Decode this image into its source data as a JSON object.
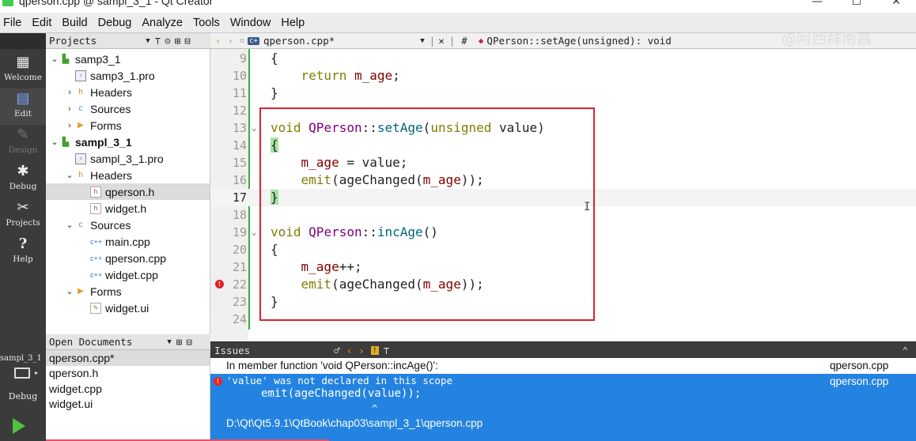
{
  "window": {
    "title": "qperson.cpp @ sampl_3_1 - Qt Creator",
    "minimize": "—",
    "maximize": "☐",
    "close": "✕"
  },
  "menu": [
    "File",
    "Edit",
    "Build",
    "Debug",
    "Analyze",
    "Tools",
    "Window",
    "Help"
  ],
  "modes": [
    {
      "label": "Welcome",
      "icon": "grid-icon",
      "glyph": "▦"
    },
    {
      "label": "Edit",
      "icon": "edit-icon",
      "glyph": "▤"
    },
    {
      "label": "Design",
      "icon": "design-pen-icon",
      "glyph": "✎"
    },
    {
      "label": "Debug",
      "icon": "bug-icon",
      "glyph": "✱"
    },
    {
      "label": "Projects",
      "icon": "wrench-icon",
      "glyph": "✂"
    },
    {
      "label": "Help",
      "icon": "help-icon",
      "glyph": "?"
    }
  ],
  "target": {
    "project": "sampl_3_1",
    "config": "Debug"
  },
  "projects_panel": {
    "title": "Projects"
  },
  "tree": [
    {
      "label": "samp3_1",
      "depth": 0,
      "arrow": "⌄",
      "icon": "proj",
      "glyph": "▙",
      "bold": false
    },
    {
      "label": "samp3_1.pro",
      "depth": 1,
      "arrow": "",
      "icon": "pro",
      "glyph": "▫",
      "bold": false
    },
    {
      "label": "Headers",
      "depth": 1,
      "arrow": "›",
      "icon": "folder",
      "glyph": "h",
      "bold": false
    },
    {
      "label": "Sources",
      "depth": 1,
      "arrow": "›",
      "icon": "src",
      "glyph": "c",
      "bold": false
    },
    {
      "label": "Forms",
      "depth": 1,
      "arrow": "›",
      "icon": "forms",
      "glyph": "▶",
      "bold": false
    },
    {
      "label": "sampl_3_1",
      "depth": 0,
      "arrow": "⌄",
      "icon": "proj",
      "glyph": "▙",
      "bold": true
    },
    {
      "label": "sampl_3_1.pro",
      "depth": 1,
      "arrow": "",
      "icon": "pro",
      "glyph": "▫",
      "bold": false
    },
    {
      "label": "Headers",
      "depth": 1,
      "arrow": "⌄",
      "icon": "folder",
      "glyph": "h",
      "bold": false
    },
    {
      "label": "qperson.h",
      "depth": 2,
      "arrow": "",
      "icon": "hdr",
      "glyph": "h",
      "bold": false,
      "selected": true
    },
    {
      "label": "widget.h",
      "depth": 2,
      "arrow": "",
      "icon": "hdr",
      "glyph": "h",
      "bold": false
    },
    {
      "label": "Sources",
      "depth": 1,
      "arrow": "⌄",
      "icon": "src",
      "glyph": "c",
      "bold": false
    },
    {
      "label": "main.cpp",
      "depth": 2,
      "arrow": "",
      "icon": "cpp",
      "glyph": "c++",
      "bold": false
    },
    {
      "label": "qperson.cpp",
      "depth": 2,
      "arrow": "",
      "icon": "cpp",
      "glyph": "c++",
      "bold": false
    },
    {
      "label": "widget.cpp",
      "depth": 2,
      "arrow": "",
      "icon": "cpp",
      "glyph": "c++",
      "bold": false
    },
    {
      "label": "Forms",
      "depth": 1,
      "arrow": "⌄",
      "icon": "forms",
      "glyph": "▶",
      "bold": false
    },
    {
      "label": "widget.ui",
      "depth": 2,
      "arrow": "",
      "icon": "ui",
      "glyph": "✎",
      "bold": false
    }
  ],
  "open_documents": {
    "title": "Open Documents",
    "docs": [
      "qperson.cpp*",
      "qperson.h",
      "widget.cpp",
      "widget.ui"
    ]
  },
  "editor": {
    "file_tab": "qperson.cpp*",
    "function_crumb": "QPerson::setAge(unsigned): void",
    "hash": "#",
    "current_line": 17,
    "lines": [
      {
        "n": 9,
        "html": "{"
      },
      {
        "n": 10,
        "html": "    <span class=\"kw\">return</span> <span class=\"mem\">m_age</span>;"
      },
      {
        "n": 11,
        "html": "}"
      },
      {
        "n": 12,
        "html": ""
      },
      {
        "n": 13,
        "fold": true,
        "html": "<span class=\"kw\">void</span> <span class=\"cls\">QPerson</span>::<span class=\"fn\">setAge</span>(<span class=\"kw\">unsigned</span> value)"
      },
      {
        "n": 14,
        "html": "<span class=\"hl\">{</span>"
      },
      {
        "n": 15,
        "html": "    <span class=\"mem\">m_age</span> = value;"
      },
      {
        "n": 16,
        "html": "    <span class=\"kw\">emit</span>(ageChanged(<span class=\"mem\">m_age</span>));"
      },
      {
        "n": 17,
        "html": "<span class=\"hl\">}</span>"
      },
      {
        "n": 18,
        "html": ""
      },
      {
        "n": 19,
        "fold": true,
        "html": "<span class=\"kw\">void</span> <span class=\"cls\">QPerson</span>::<span class=\"fn\">incAge</span>()"
      },
      {
        "n": 20,
        "html": "{"
      },
      {
        "n": 21,
        "html": "    <span class=\"mem\">m_age</span>++;"
      },
      {
        "n": 22,
        "bp": true,
        "html": "    <span class=\"kw\">emit</span>(ageChanged(<span class=\"mem\">m_age</span>));"
      },
      {
        "n": 23,
        "html": "}"
      },
      {
        "n": 24,
        "html": ""
      }
    ]
  },
  "watermark": "@阿西拜南昌",
  "issues": {
    "title": "Issues",
    "context": "In member function 'void QPerson::incAge()':",
    "context_file": "qperson.cpp",
    "message": "'value' was not declared in this scope",
    "code_line": "emit(ageChanged(value));",
    "caret": "^",
    "path": "D:\\Qt\\Qt5.9.1\\QtBook\\chap03\\sampl_3_1\\qperson.cpp",
    "file": "qperson.cpp"
  },
  "colors": {
    "accent_selection": "#2483e0",
    "error": "#e22222",
    "highlight_box": "#d8242e",
    "saved_bar": "#3aad3a"
  }
}
